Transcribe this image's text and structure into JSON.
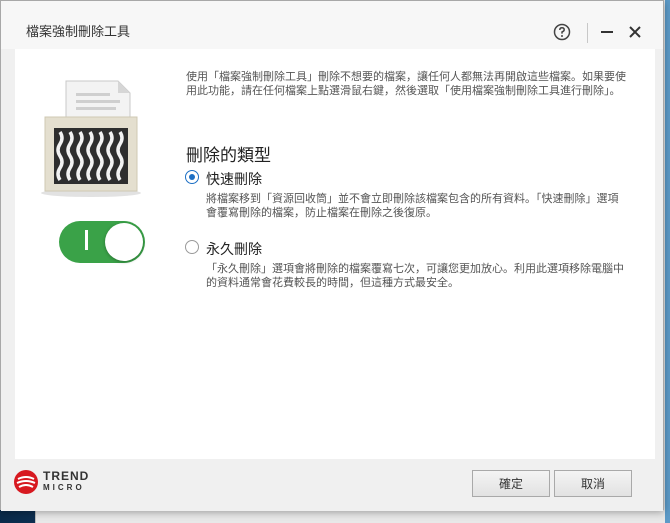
{
  "window": {
    "title": "檔案強制刪除工具",
    "help_icon": "question-circle-icon",
    "minimize_icon": "minimize-icon",
    "close_icon": "close-icon"
  },
  "illustration": {
    "icon": "shredder-icon",
    "toggle_state": "on"
  },
  "intro_text": "使用「檔案強制刪除工具」刪除不想要的檔案，讓任何人都無法再開啟這些檔案。如果要使用此功能，請在任何檔案上點選滑鼠右鍵，然後選取「使用檔案強制刪除工具進行刪除」。",
  "section_title": "刪除的類型",
  "options": [
    {
      "label": "快速刪除",
      "description": "將檔案移到「資源回收筒」並不會立即刪除該檔案包含的所有資料。「快速刪除」選項會覆寫刪除的檔案，防止檔案在刪除之後復原。",
      "selected": true
    },
    {
      "label": "永久刪除",
      "description": "「永久刪除」選項會將刪除的檔案覆寫七次，可讓您更加放心。利用此選項移除電腦中的資料通常會花費較長的時間，但這種方式最安全。",
      "selected": false
    }
  ],
  "footer": {
    "logo_line1": "TREND",
    "logo_line2": "MICRO",
    "ok_label": "確定",
    "cancel_label": "取消"
  },
  "colors": {
    "toggle_on": "#3aa248",
    "radio_selected": "#1c6fc4",
    "brand_red": "#d71920"
  }
}
